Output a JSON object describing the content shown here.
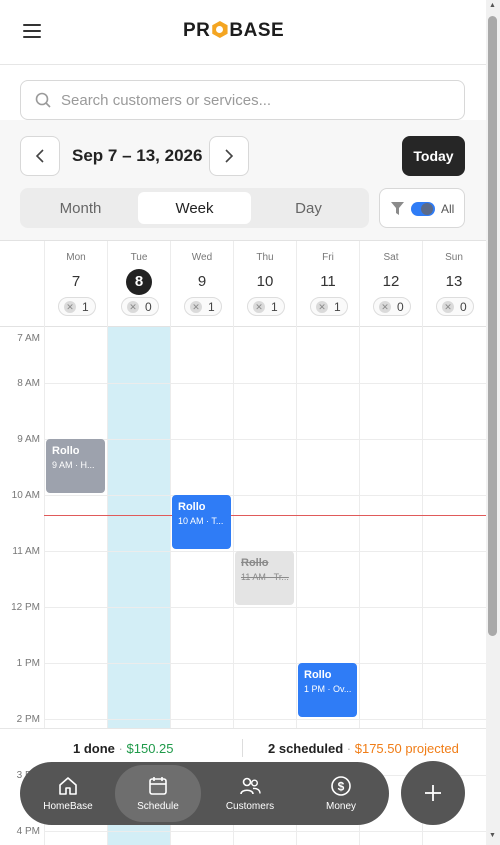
{
  "header": {
    "brand": "PROBASE",
    "brand_pre": "PR",
    "brand_post": "BASE"
  },
  "search": {
    "placeholder": "Search customers or services..."
  },
  "toolbar": {
    "range": "Sep 7 – 13, 2026",
    "today_label": "Today",
    "filter_label": "All"
  },
  "view_options": [
    {
      "label": "Month",
      "active": false
    },
    {
      "label": "Week",
      "active": true
    },
    {
      "label": "Day",
      "active": false
    }
  ],
  "days": [
    {
      "name": "Mon",
      "num": "7",
      "count": "1",
      "today": false
    },
    {
      "name": "Tue",
      "num": "8",
      "count": "0",
      "today": true
    },
    {
      "name": "Wed",
      "num": "9",
      "count": "1",
      "today": false
    },
    {
      "name": "Thu",
      "num": "10",
      "count": "1",
      "today": false
    },
    {
      "name": "Fri",
      "num": "11",
      "count": "1",
      "today": false
    },
    {
      "name": "Sat",
      "num": "12",
      "count": "0",
      "today": false
    },
    {
      "name": "Sun",
      "num": "13",
      "count": "0",
      "today": false
    }
  ],
  "hours": [
    "7 AM",
    "8 AM",
    "9 AM",
    "10 AM",
    "11 AM",
    "12 PM",
    "1 PM",
    "2 PM",
    "3 PM",
    "4 PM"
  ],
  "events": [
    {
      "title": "Rollo",
      "sub": "9 AM · H...",
      "status": "completed",
      "color": "#9da2ad"
    },
    {
      "title": "Rollo",
      "sub": "10 AM · T...",
      "status": "scheduled",
      "color": "#2f7cf6"
    },
    {
      "title": "Rollo",
      "sub": "11 AM · Tr...",
      "status": "cancelled",
      "color": "#e4e4e4"
    },
    {
      "title": "Rollo",
      "sub": "1 PM · Ov...",
      "status": "scheduled",
      "color": "#2f7cf6"
    }
  ],
  "summary": {
    "done_label": "1 done",
    "done_amount": "$150.25",
    "scheduled_label": "2 scheduled",
    "scheduled_amount": "$175.50 projected"
  },
  "tabs": [
    {
      "label": "HomeBase",
      "icon": "home-icon",
      "active": false
    },
    {
      "label": "Schedule",
      "icon": "calendar-icon",
      "active": true
    },
    {
      "label": "Customers",
      "icon": "users-icon",
      "active": false
    },
    {
      "label": "Money",
      "icon": "dollar-icon",
      "active": false
    }
  ],
  "colors": {
    "accent": "#2f7cf6",
    "dark": "#262626",
    "today_column": "#d3eef6",
    "now_line": "#e05a5a",
    "money_green": "#1f9a4a",
    "projected_orange": "#f07d17"
  }
}
